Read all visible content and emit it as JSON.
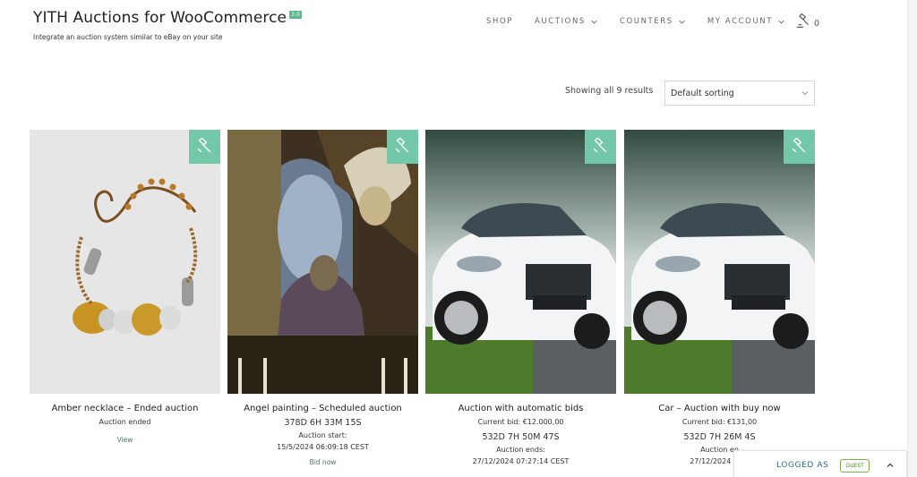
{
  "site": {
    "title": "YITH Auctions for WooCommerce",
    "version": "3.0",
    "description": "Integrate an auction system similar to eBay on your site"
  },
  "nav": {
    "items": [
      {
        "label": "SHOP"
      },
      {
        "label": "AUCTIONS"
      },
      {
        "label": "COUNTERS"
      },
      {
        "label": "MY ACCOUNT"
      }
    ],
    "cart_count": "0",
    "cart_icon": "auction-gavel-cart-icon"
  },
  "shop": {
    "results": "Showing all 9 results",
    "sorting": "Default sorting"
  },
  "products": [
    {
      "title": "Amber necklace – Ended auction",
      "status": "Auction ended",
      "link": "View"
    },
    {
      "title": "Angel painting – Scheduled auction",
      "countdown": "378D 6H 33M 15S",
      "date_label": "Auction start:",
      "date": "15/5/2024 06:09:18 CEST",
      "link": "Bid now"
    },
    {
      "title": "Auction with automatic bids",
      "bid": "Current bid: €12.000,00",
      "countdown": "532D 7H 50M 47S",
      "date_label": "Auction ends:",
      "date": "27/12/2024 07:27:14 CEST"
    },
    {
      "title": "Car – Auction with buy now",
      "bid": "Current bid: €131,00",
      "countdown": "532D 7H 26M 4S",
      "date_label": "Auction en",
      "date": "27/12/2024 07:0"
    }
  ],
  "session": {
    "label": "LOGGED AS",
    "role": "GUEST"
  },
  "colors": {
    "accent": "#72c8a9",
    "badge": "#5bb88c",
    "logged_label": "#2f6a8d",
    "guest_border": "#7ab34b"
  }
}
